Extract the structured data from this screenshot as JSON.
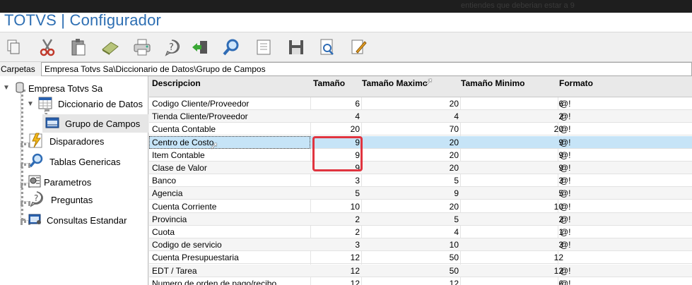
{
  "overlay_text": "entiendes que deberian estar a 9",
  "app": {
    "title": "TOTVS | Configurador"
  },
  "toolbar": {
    "icons": [
      "copy-icon",
      "cut-icon",
      "paste-icon",
      "eraser-icon",
      "print-icon",
      "help-icon",
      "exit-icon",
      "search-icon",
      "list-icon",
      "save-icon",
      "preview-icon",
      "edit-icon"
    ]
  },
  "path": {
    "label": "Carpetas",
    "value": "Empresa Totvs Sa\\Diccionario de Datos\\Grupo de Campos"
  },
  "tree": {
    "root": "Empresa Totvs Sa",
    "dictionary": "Diccionario de Datos",
    "field_group": "Grupo de Campos",
    "triggers": "Disparadores",
    "generic_tables": "Tablas Genericas",
    "parameters": "Parametros",
    "questions": "Preguntas",
    "standard_queries": "Consultas Estandar"
  },
  "grid": {
    "headers": [
      "Descripcion",
      "Tamaño",
      "Tamaño Maximo",
      "Tamaño Minimo",
      "Formato"
    ],
    "rows": [
      [
        "Codigo Cliente/Proveedor",
        "6",
        "20",
        "6",
        "@!"
      ],
      [
        "Tienda Cliente/Proveedor",
        "4",
        "4",
        "2",
        "@!"
      ],
      [
        "Cuenta Contable",
        "20",
        "70",
        "20",
        "@!"
      ],
      [
        "Centro de Costo",
        "9",
        "20",
        "9",
        "@!"
      ],
      [
        "Item Contable",
        "9",
        "20",
        "9",
        "@!"
      ],
      [
        "Clase de Valor",
        "9",
        "20",
        "9",
        "@!"
      ],
      [
        "Banco",
        "3",
        "5",
        "3",
        "@!"
      ],
      [
        "Agencia",
        "5",
        "9",
        "5",
        "@!"
      ],
      [
        "Cuenta Corriente",
        "10",
        "20",
        "10",
        "@!"
      ],
      [
        "Provincia",
        "2",
        "5",
        "2",
        "@!"
      ],
      [
        "Cuota",
        "2",
        "4",
        "1",
        "@!"
      ],
      [
        "Codigo de servicio",
        "3",
        "10",
        "3",
        "@!"
      ],
      [
        "Cuenta Presupuestaria",
        "12",
        "50",
        "12",
        ""
      ],
      [
        "EDT / Tarea",
        "12",
        "50",
        "12",
        "@!"
      ],
      [
        "Numero de orden de pago/recibo",
        "12",
        "12",
        "6",
        "@!"
      ]
    ],
    "selected_row": 3
  },
  "colors": {
    "title": "#2e6fb3",
    "selection": "#c6e4f7",
    "highlight": "#e0343f"
  }
}
